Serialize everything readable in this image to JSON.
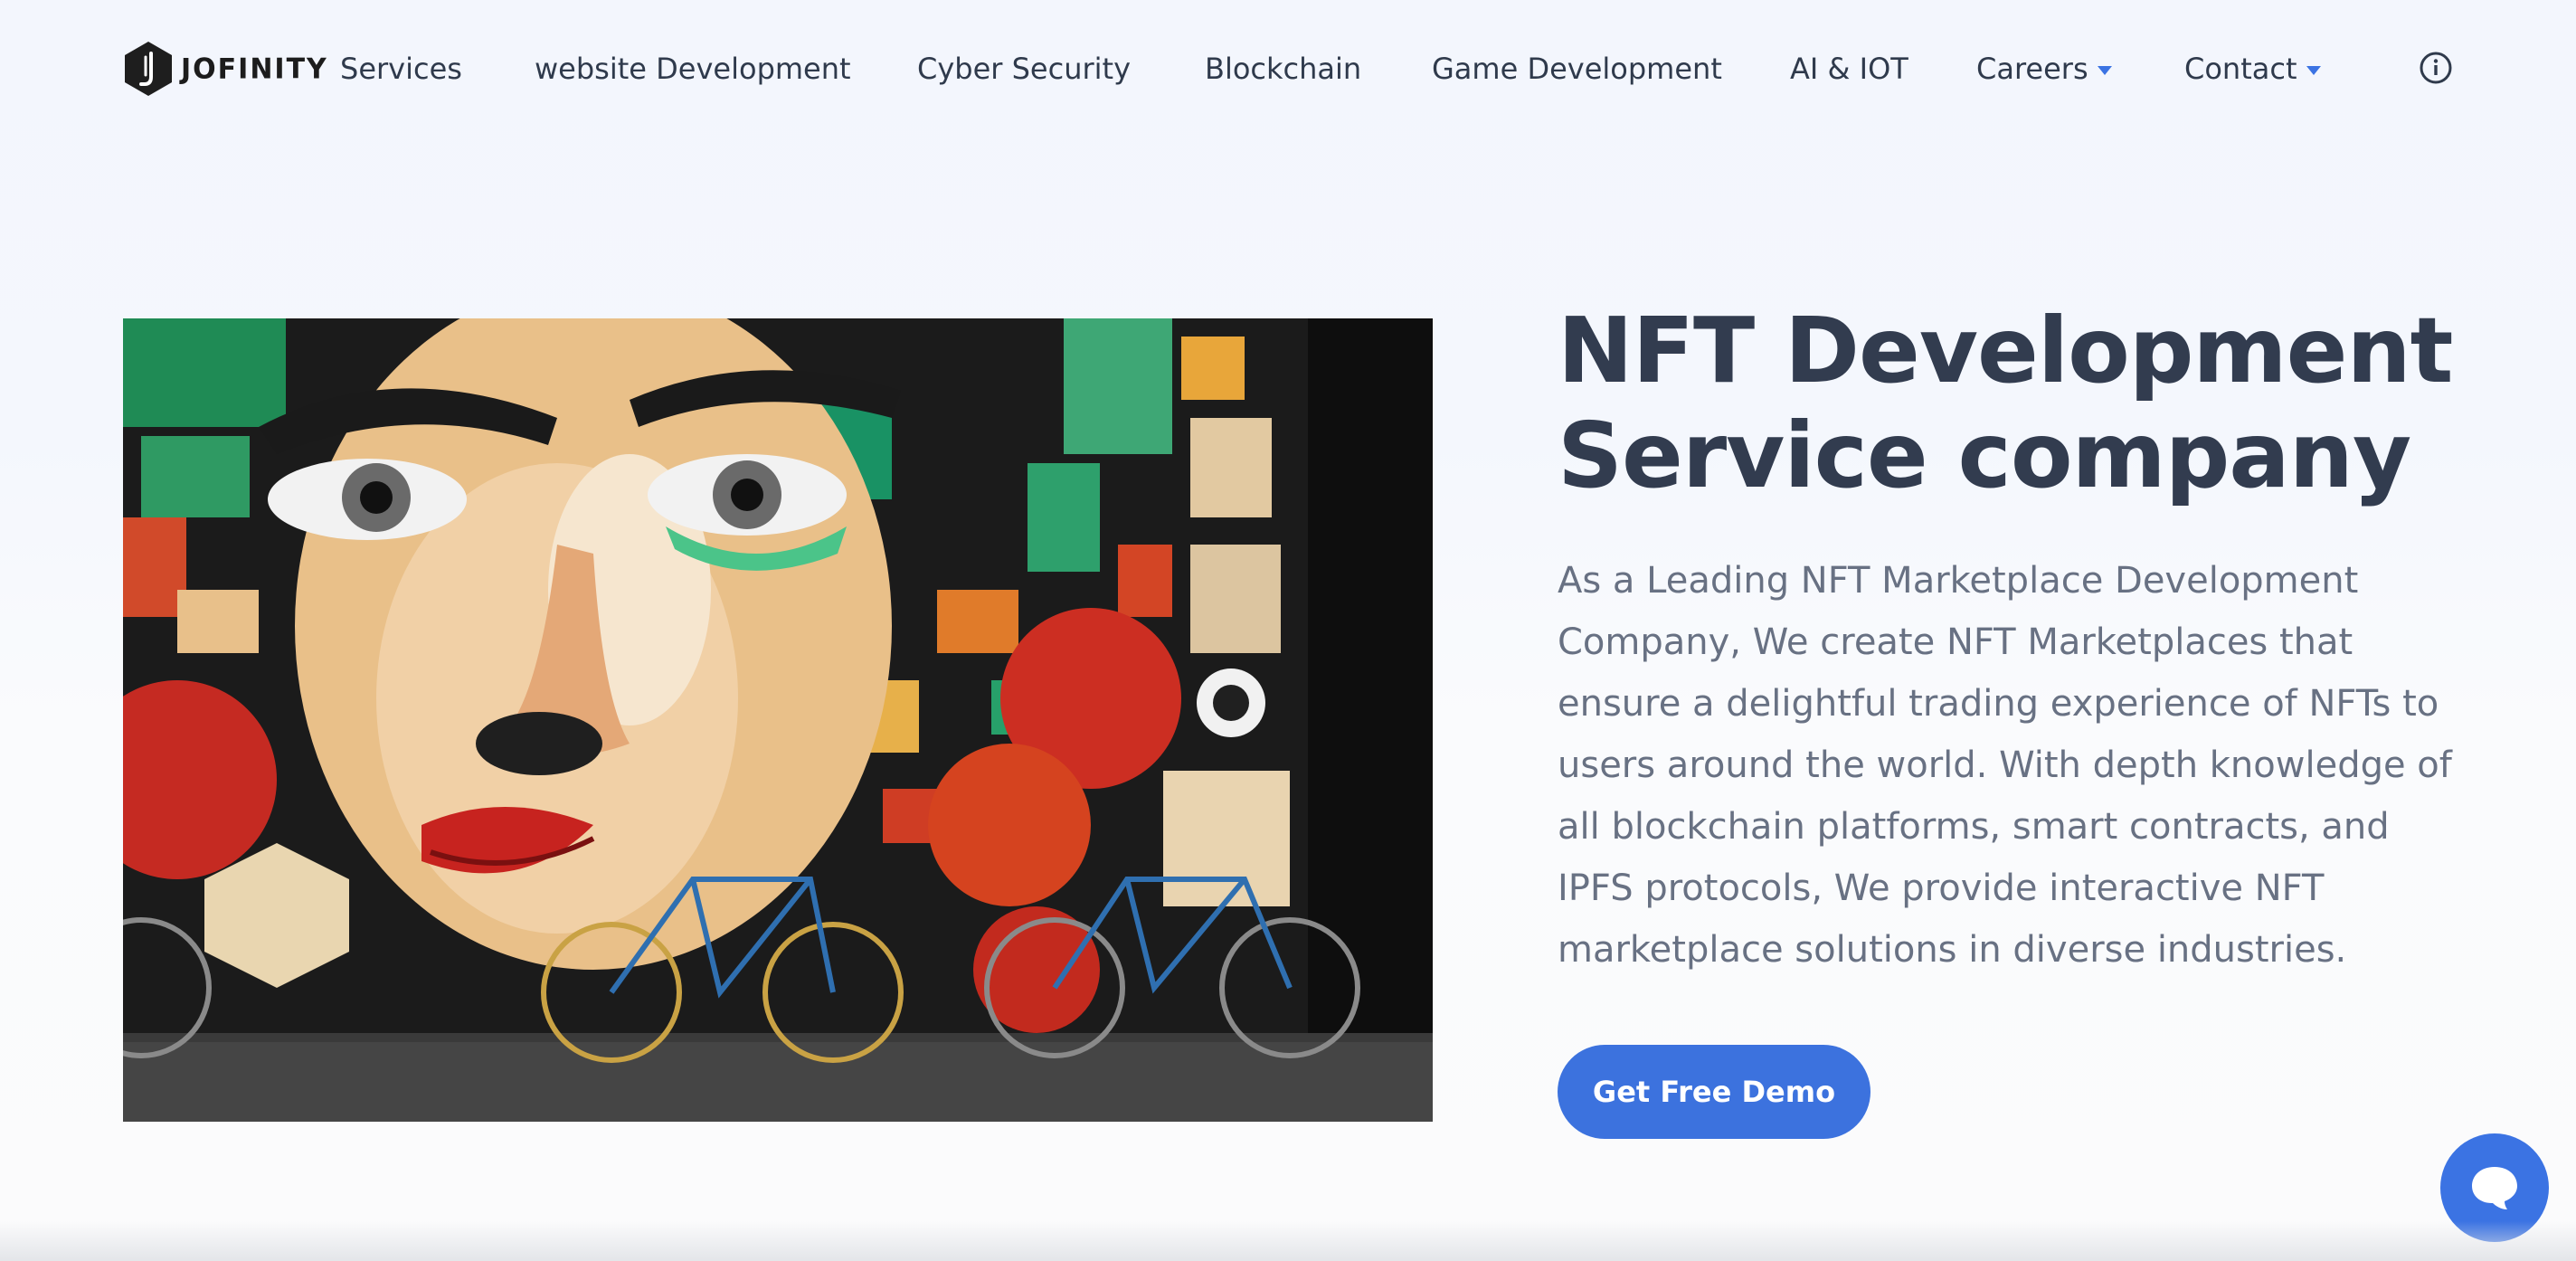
{
  "brand": {
    "name": "JOFINITY"
  },
  "nav": {
    "items": [
      {
        "label": "Services",
        "has_dropdown": false
      },
      {
        "label": "website Development",
        "has_dropdown": false
      },
      {
        "label": "Cyber Security",
        "has_dropdown": false
      },
      {
        "label": "Blockchain",
        "has_dropdown": false
      },
      {
        "label": "Game Development",
        "has_dropdown": false
      },
      {
        "label": "AI & IOT",
        "has_dropdown": false
      },
      {
        "label": "Careers",
        "has_dropdown": true
      },
      {
        "label": "Contact",
        "has_dropdown": true
      }
    ],
    "info_icon": "info-circle-icon"
  },
  "hero": {
    "title": "NFT Development Service company",
    "description": "As a Leading NFT Marketplace Development Company, We create NFT Marketplaces that ensure a delightful trading experience of NFTs to users around the world. With depth knowledge of all blockchain platforms, smart contracts, and IPFS protocols, We provide interactive NFT marketplace solutions in diverse industries.",
    "cta_label": "Get Free Demo",
    "image_alt": "Graffiti mural of a woman's face with bicycles parked in front"
  },
  "chat": {
    "icon": "chat-bubble-icon"
  },
  "colors": {
    "accent": "#3c72de",
    "title": "#323c4f",
    "body_text": "#687183",
    "nav_text": "#2f3a4c",
    "caret": "#3b73e3"
  }
}
